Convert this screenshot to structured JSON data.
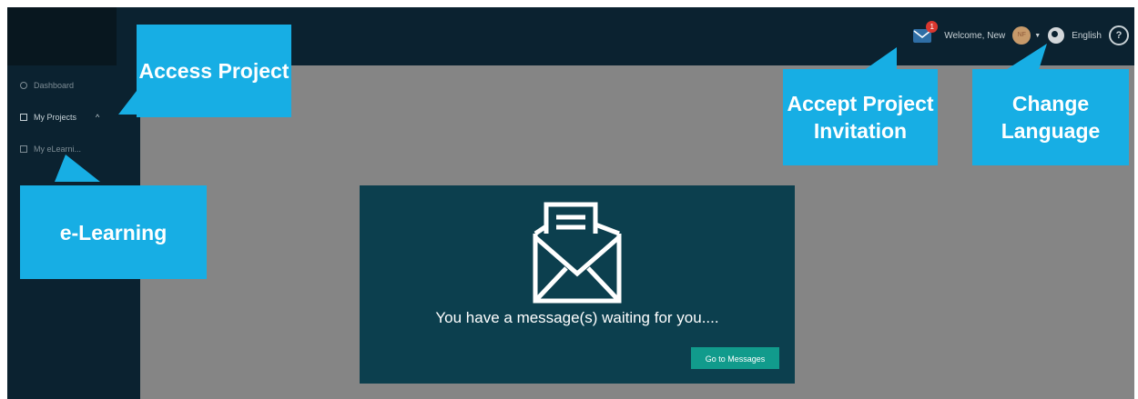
{
  "sidebar": {
    "items": [
      {
        "label": "Dashboard"
      },
      {
        "label": "My Projects"
      },
      {
        "label": "My eLearni..."
      }
    ]
  },
  "header": {
    "welcome": "Welcome, New",
    "mail_badge": "1",
    "avatar_initials": "NF",
    "language": "English",
    "help": "?"
  },
  "callouts": {
    "access_project": "Access Project",
    "elearning": "e-Learning",
    "accept_invitation": "Accept Project Invitation",
    "change_language": "Change Language"
  },
  "message_panel": {
    "text": "You have a message(s) waiting for you....",
    "button": "Go to Messages"
  },
  "colors": {
    "topbar": "#0b2230",
    "content": "#858585",
    "callout": "#17aee4",
    "panel": "#0c3f4e",
    "button": "#119b8c"
  }
}
